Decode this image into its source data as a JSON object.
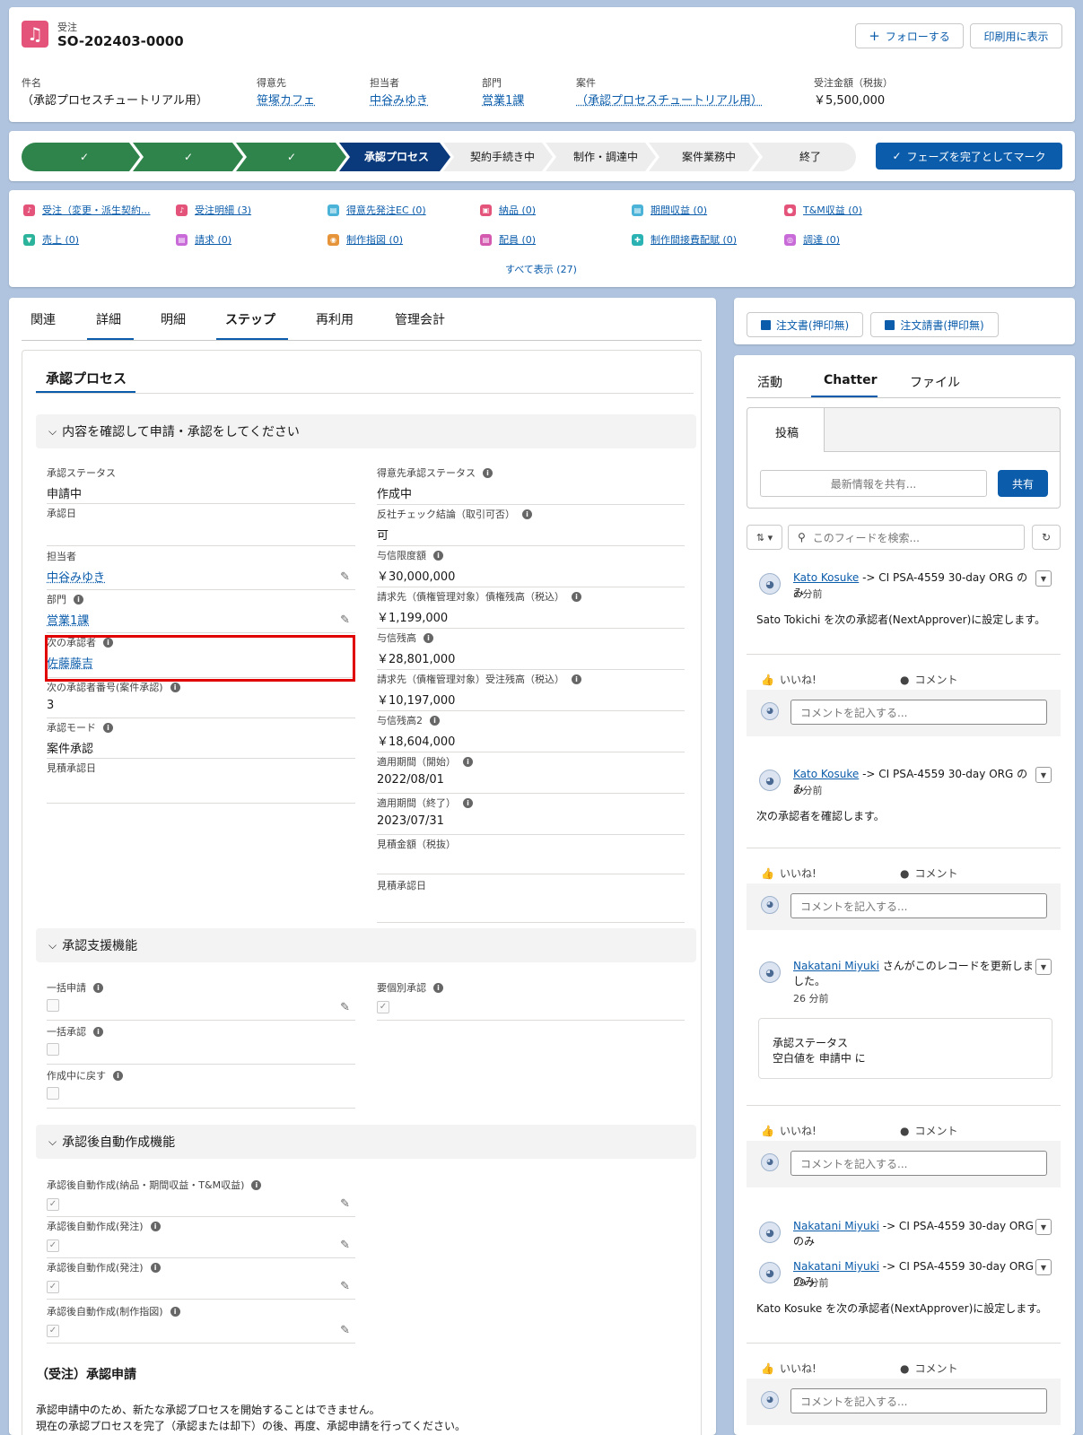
{
  "header": {
    "object_label": "受注",
    "record_name": "SO-202403-0000",
    "follow_label": "フォローする",
    "print_label": "印刷用に表示",
    "fields": [
      {
        "label": "件名",
        "value": "（承認プロセスチュートリアル用）",
        "link": false
      },
      {
        "label": "得意先",
        "value": "笹塚カフェ",
        "link": true
      },
      {
        "label": "担当者",
        "value": "中谷みゆき",
        "link": true
      },
      {
        "label": "部門",
        "value": "営業1課",
        "link": true
      },
      {
        "label": "案件",
        "value": "（承認プロセスチュートリアル用）",
        "link": true
      },
      {
        "label": "受注金額（税抜）",
        "value": "￥5,500,000",
        "link": false
      }
    ]
  },
  "path": {
    "steps": [
      "✓",
      "✓",
      "✓",
      "承認プロセス",
      "契約手続き中",
      "制作・調達中",
      "案件業務中",
      "終了"
    ],
    "mark_label": "フェーズを完了としてマーク"
  },
  "related": {
    "items": [
      {
        "label": "受注（変更・派生契約...",
        "color": "#e4547a",
        "icon": "♪"
      },
      {
        "label": "受注明細 (3)",
        "color": "#e4547a",
        "icon": "♪"
      },
      {
        "label": "得意先発注EC (0)",
        "color": "#4bb3d8",
        "icon": "▤"
      },
      {
        "label": "納品 (0)",
        "color": "#e4547a",
        "icon": "▣"
      },
      {
        "label": "期間収益 (0)",
        "color": "#4bb3d8",
        "icon": "▤"
      },
      {
        "label": "T&M収益 (0)",
        "color": "#e4547a",
        "icon": "●"
      },
      {
        "label": "売上 (0)",
        "color": "#2bb39b",
        "icon": "▼"
      },
      {
        "label": "請求 (0)",
        "color": "#c86ad8",
        "icon": "▤"
      },
      {
        "label": "制作指図 (0)",
        "color": "#e6943a",
        "icon": "◉"
      },
      {
        "label": "配員 (0)",
        "color": "#d45ab0",
        "icon": "▤"
      },
      {
        "label": "制作間接費配賦 (0)",
        "color": "#2bb3b3",
        "icon": "✚"
      },
      {
        "label": "調達 (0)",
        "color": "#c86ad8",
        "icon": "◎"
      }
    ],
    "show_all": "すべて表示 (27)"
  },
  "main_tabs": [
    "関連",
    "詳細",
    "明細",
    "ステップ",
    "再利用",
    "管理会計"
  ],
  "approval": {
    "title": "承認プロセス",
    "section1": "内容を確認して申請・承認をしてください",
    "left_fields": [
      {
        "label": "承認ステータス",
        "value": "申請中"
      },
      {
        "label": "承認日",
        "value": ""
      },
      {
        "label": "担当者",
        "value": "中谷みゆき"
      },
      {
        "label": "部門",
        "value": "営業1課"
      },
      {
        "label": "次の承認者",
        "value": "佐藤藤吉"
      },
      {
        "label": "次の承認者番号(案件承認)",
        "value": "3"
      },
      {
        "label": "承認モード",
        "value": "案件承認"
      },
      {
        "label": "見積承認日",
        "value": ""
      }
    ],
    "right_fields": [
      {
        "label": "得意先承認ステータス",
        "value": "作成中"
      },
      {
        "label": "反社チェック結論（取引可否）",
        "value": "可"
      },
      {
        "label": "与信限度額",
        "value": "￥30,000,000"
      },
      {
        "label": "請求先（債権管理対象）債権残高（税込）",
        "value": "￥1,199,000"
      },
      {
        "label": "与信残高",
        "value": "￥28,801,000"
      },
      {
        "label": "請求先（債権管理対象）受注残高（税込）",
        "value": "￥10,197,000"
      },
      {
        "label": "与信残高2",
        "value": "￥18,604,000"
      },
      {
        "label": "適用期間（開始）",
        "value": "2022/08/01"
      },
      {
        "label": "適用期間（終了）",
        "value": "2023/07/31"
      },
      {
        "label": "見積金額（税抜）",
        "value": ""
      },
      {
        "label": "見積承認日",
        "value": ""
      }
    ],
    "section2": "承認支援機能",
    "support_left": [
      "一括申請",
      "一括承認",
      "作成中に戻す"
    ],
    "support_right": "要個別承認",
    "section3": "承認後自動作成機能",
    "auto_fields": [
      "承認後自動作成(納品・期間収益・T&M収益)",
      "承認後自動作成(発注)",
      "承認後自動作成(発注)",
      "承認後自動作成(制作指図)"
    ],
    "request_title": "（受注）承認申請",
    "request_line1": "承認申請中のため、新たな承認プロセスを開始することはできません。",
    "request_line2": "現在の承認プロセスを完了（承認または却下）の後、再度、承認申請を行ってください。"
  },
  "side_buttons": [
    "注文書(押印無)",
    "注文請書(押印無)"
  ],
  "chatter": {
    "tabs": [
      "活動",
      "Chatter",
      "ファイル"
    ],
    "post_tab": "投稿",
    "share_placeholder": "最新情報を共有...",
    "share_button": "共有",
    "search_placeholder": "このフィードを検索...",
    "like": "いいね!",
    "comment": "コメント",
    "comment_placeholder": "コメントを記入する...",
    "posts": [
      {
        "user": "Kato Kosuke",
        "rest": " -> CI PSA-4559 30-day ORG のみ",
        "time": "3 分前",
        "body": "Sato Tokichi を次の承認者(NextApprover)に設定します。"
      },
      {
        "user": "Kato Kosuke",
        "rest": " -> CI PSA-4559 30-day ORG のみ",
        "time": "3 分前",
        "body": "次の承認者を確認します。"
      },
      {
        "user": "Nakatani Miyuki",
        "rest": " さんがこのレコードを更新しました。",
        "time": "26 分前",
        "change_label": "承認ステータス",
        "change_text": "空白値を 申請中 に"
      },
      {
        "user": "Nakatani Miyuki",
        "rest": " -> CI PSA-4559 30-day ORG のみ"
      },
      {
        "user": "Nakatani Miyuki",
        "rest": " -> CI PSA-4559 30-day ORG のみ",
        "time": "29 分前",
        "body": "Kato Kosuke を次の承認者(NextApprover)に設定します。"
      }
    ]
  }
}
